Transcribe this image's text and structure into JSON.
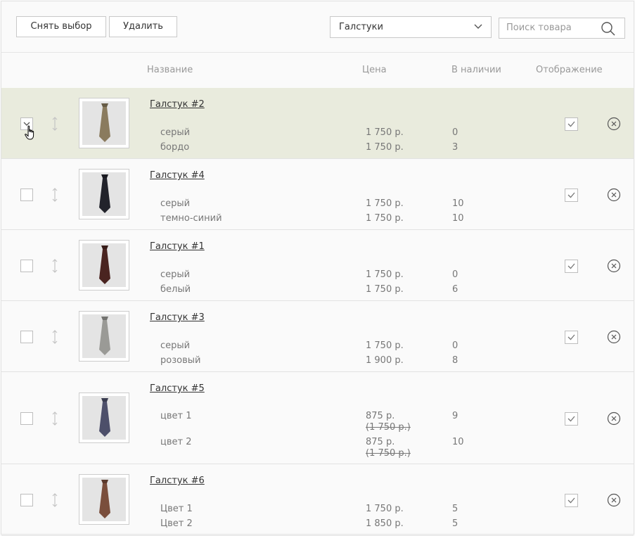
{
  "toolbar": {
    "deselect_label": "Снять выбор",
    "delete_label": "Удалить",
    "category_value": "Галстуки",
    "search_placeholder": "Поиск товара"
  },
  "columns": {
    "name": "Название",
    "price": "Цена",
    "stock": "В наличии",
    "visibility": "Отображение"
  },
  "products": [
    {
      "title": "Галстук #2",
      "selected": true,
      "visible": true,
      "tie_color": "#8a7b5e",
      "variants": [
        {
          "name": "серый",
          "price": "1 750 р.",
          "qty": "0"
        },
        {
          "name": "бордо",
          "price": "1 750 р.",
          "qty": "3"
        }
      ]
    },
    {
      "title": "Галстук #4",
      "selected": false,
      "visible": true,
      "tie_color": "#22232b",
      "variants": [
        {
          "name": "серый",
          "price": "1 750 р.",
          "qty": "10"
        },
        {
          "name": "темно-синий",
          "price": "1 750 р.",
          "qty": "10"
        }
      ]
    },
    {
      "title": "Галстук #1",
      "selected": false,
      "visible": true,
      "tie_color": "#4a2420",
      "variants": [
        {
          "name": "серый",
          "price": "1 750 р.",
          "qty": "0"
        },
        {
          "name": "белый",
          "price": "1 750 р.",
          "qty": "6"
        }
      ]
    },
    {
      "title": "Галстук #3",
      "selected": false,
      "visible": true,
      "tie_color": "#9a9a96",
      "variants": [
        {
          "name": "серый",
          "price": "1 750 р.",
          "qty": "0"
        },
        {
          "name": "розовый",
          "price": "1 900 р.",
          "qty": "8"
        }
      ]
    },
    {
      "title": "Галстук #5",
      "selected": false,
      "visible": true,
      "tie_color": "#4d4f6a",
      "variants": [
        {
          "name": "цвет 1",
          "price": "875 р.",
          "old_price": "(1 750 р.)",
          "qty": "9"
        },
        {
          "name": "цвет 2",
          "price": "875 р.",
          "old_price": "(1 750 р.)",
          "qty": "10"
        }
      ]
    },
    {
      "title": "Галстук #6",
      "selected": false,
      "visible": true,
      "tie_color": "#7a4e3c",
      "variants": [
        {
          "name": "Цвет 1",
          "price": "1 750 р.",
          "qty": "5"
        },
        {
          "name": "Цвет 2",
          "price": "1 850 р.",
          "qty": "5"
        }
      ]
    }
  ],
  "icons": {
    "category_chevron": "chevron-down-icon",
    "search": "search-icon",
    "drag": "drag-handle-icon",
    "visible_check": "check-icon",
    "delete": "close-circle-icon",
    "cursor": "hand-cursor-icon"
  }
}
